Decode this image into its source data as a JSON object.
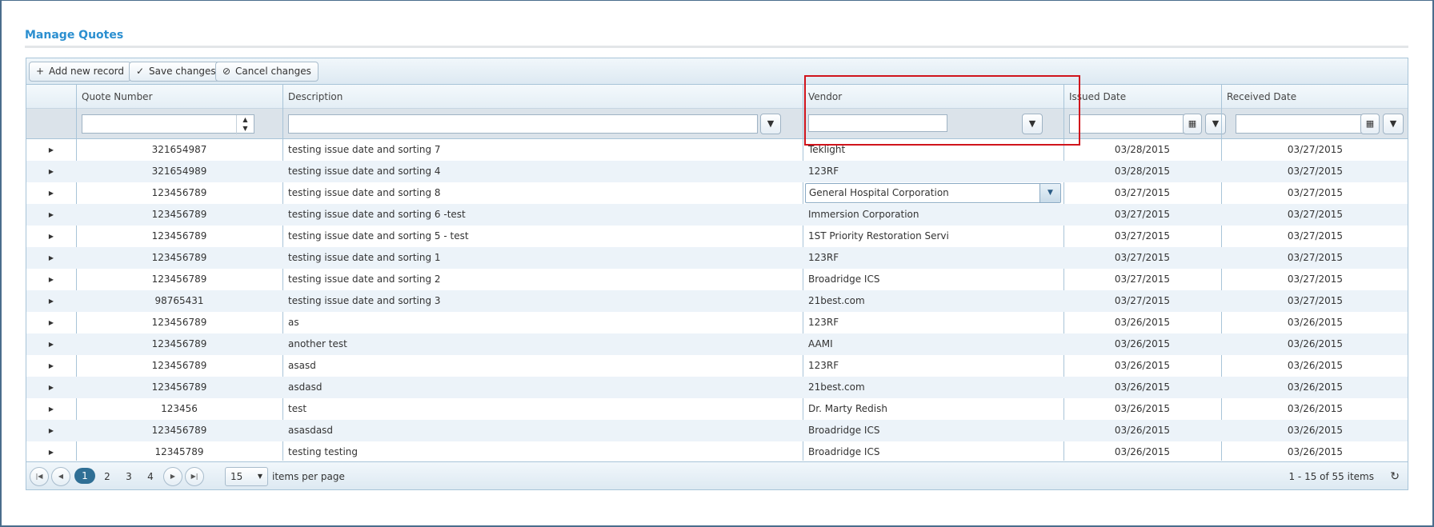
{
  "page": {
    "title": "Manage Quotes"
  },
  "toolbar": {
    "add_label": "Add new record",
    "save_label": "Save changes",
    "cancel_label": "Cancel changes"
  },
  "columns": {
    "quote_number": "Quote Number",
    "description": "Description",
    "vendor": "Vendor",
    "issued_date": "Issued Date",
    "received_date": "Received Date"
  },
  "rows": [
    {
      "quote": "321654987",
      "desc": "testing issue date and sorting 7",
      "vendor": "Teklight",
      "issued": "03/28/2015",
      "received": "03/27/2015"
    },
    {
      "quote": "321654989",
      "desc": "testing issue date and sorting 4",
      "vendor": "123RF",
      "issued": "03/28/2015",
      "received": "03/27/2015"
    },
    {
      "quote": "123456789",
      "desc": "testing issue date and sorting 8",
      "vendor": "General Hospital Corporation",
      "issued": "03/27/2015",
      "received": "03/27/2015"
    },
    {
      "quote": "123456789",
      "desc": "testing issue date and sorting 6 -test",
      "vendor": "Immersion Corporation",
      "issued": "03/27/2015",
      "received": "03/27/2015"
    },
    {
      "quote": "123456789",
      "desc": "testing issue date and sorting 5 - test",
      "vendor": "1ST Priority Restoration Servi",
      "issued": "03/27/2015",
      "received": "03/27/2015"
    },
    {
      "quote": "123456789",
      "desc": "testing issue date and sorting 1",
      "vendor": "123RF",
      "issued": "03/27/2015",
      "received": "03/27/2015"
    },
    {
      "quote": "123456789",
      "desc": "testing issue date and sorting 2",
      "vendor": "Broadridge ICS",
      "issued": "03/27/2015",
      "received": "03/27/2015"
    },
    {
      "quote": "98765431",
      "desc": "testing issue date and sorting 3",
      "vendor": "21best.com",
      "issued": "03/27/2015",
      "received": "03/27/2015"
    },
    {
      "quote": "123456789",
      "desc": "as",
      "vendor": "123RF",
      "issued": "03/26/2015",
      "received": "03/26/2015"
    },
    {
      "quote": "123456789",
      "desc": "another test",
      "vendor": "AAMI",
      "issued": "03/26/2015",
      "received": "03/26/2015"
    },
    {
      "quote": "123456789",
      "desc": "asasd",
      "vendor": "123RF",
      "issued": "03/26/2015",
      "received": "03/26/2015"
    },
    {
      "quote": "123456789",
      "desc": "asdasd",
      "vendor": "21best.com",
      "issued": "03/26/2015",
      "received": "03/26/2015"
    },
    {
      "quote": "123456",
      "desc": "test",
      "vendor": "Dr. Marty Redish",
      "issued": "03/26/2015",
      "received": "03/26/2015"
    },
    {
      "quote": "123456789",
      "desc": "asasdasd",
      "vendor": "Broadridge ICS",
      "issued": "03/26/2015",
      "received": "03/26/2015"
    },
    {
      "quote": "12345789",
      "desc": "testing testing",
      "vendor": "Broadridge ICS",
      "issued": "03/26/2015",
      "received": "03/26/2015"
    }
  ],
  "pager": {
    "pages": [
      "1",
      "2",
      "3",
      "4"
    ],
    "page_size": "15",
    "items_per_page_label": "items per page",
    "summary": "1 - 15 of 55 items"
  },
  "icons": {
    "expand": "row-expand-icon",
    "filter": "filter-icon",
    "calendar": "calendar-icon",
    "refresh": "refresh-icon"
  },
  "colors": {
    "title": "#2b8fd0",
    "active_page": "#2f6f95",
    "alt_row": "#ecf3f9",
    "highlight_box": "#d0141c"
  }
}
